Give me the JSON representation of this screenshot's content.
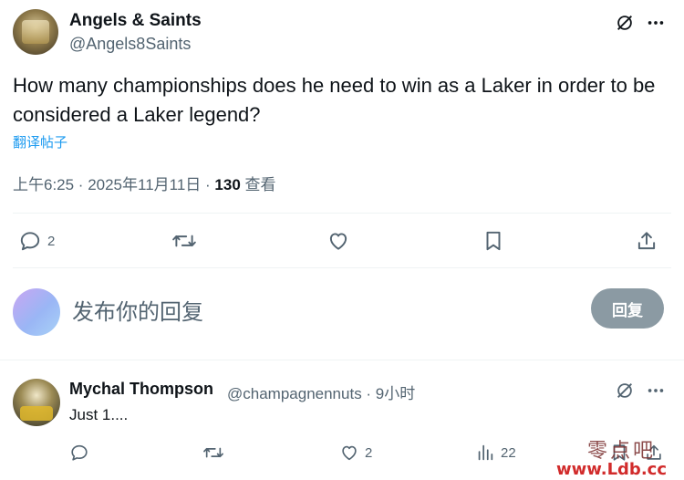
{
  "post": {
    "author_name": "Angels & Saints",
    "author_handle": "@Angels8Saints",
    "text": "How many championships does he need to win as a Laker in order to be considered a Laker legend?",
    "translate_label": "翻译帖子",
    "time": "上午6:25 · 2025年11月11日 · ",
    "views_count": "130",
    "views_label": " 查看",
    "actions": {
      "reply_count": "2",
      "retweet_count": "",
      "like_count": "",
      "bookmark_count": ""
    }
  },
  "compose": {
    "placeholder": "发布你的回复",
    "reply_button": "回复"
  },
  "reply": {
    "author_name": "Mychal Thompson",
    "author_handle_time": "@champagnennuts · 9小时",
    "text": "Just 1....",
    "actions": {
      "reply_count": "",
      "retweet_count": "",
      "like_count": "2",
      "views_count": "22"
    }
  },
  "watermark": {
    "cn": "零点吧",
    "url": "www.Ldb.cc"
  },
  "icons": [
    "grok-icon",
    "more-icon",
    "reply-icon",
    "retweet-icon",
    "like-icon",
    "bookmark-icon",
    "share-icon",
    "views-icon"
  ],
  "colors": {
    "text": "#0f1419",
    "secondary": "#536471",
    "link": "#1d9bf0",
    "reply_button": "#8b9aa3"
  }
}
